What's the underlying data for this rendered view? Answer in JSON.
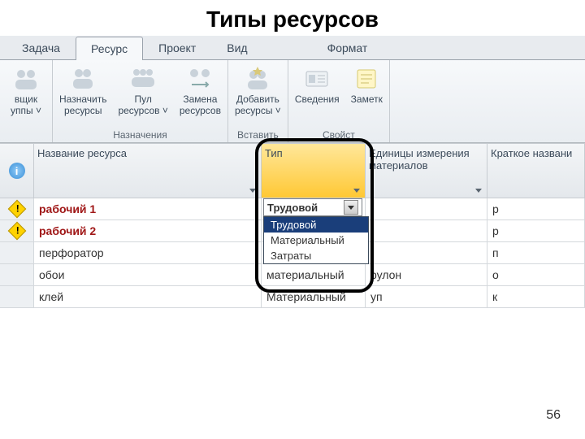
{
  "slide": {
    "title": "Типы ресурсов",
    "page_number": "56"
  },
  "tabs": {
    "task": "Задача",
    "resource": "Ресурс",
    "project": "Проект",
    "view": "Вид",
    "format": "Формат"
  },
  "ribbon": {
    "group_left_partial": {
      "btn1_line1": "вщик",
      "btn1_line2": "уппы ˅"
    },
    "assignments": {
      "label": "Назначения",
      "assign": "Назначить\nресурсы",
      "pool": "Пул\nресурсов ˅",
      "replace": "Замена\nресурсов"
    },
    "insert": {
      "label": "Вставить",
      "add": "Добавить\nресурсы ˅"
    },
    "properties": {
      "label": "Свойст",
      "details": "Сведения",
      "notes": "Заметк"
    }
  },
  "grid": {
    "headers": {
      "name": "Название ресурса",
      "type": "Тип",
      "units": "Единицы измерения материалов",
      "short": "Краткое названи"
    },
    "rows": [
      {
        "warn": true,
        "name": "рабочий 1",
        "labor": true,
        "type": "",
        "unit": "",
        "short": "р"
      },
      {
        "warn": true,
        "name": "рабочий 2",
        "labor": true,
        "type": "",
        "unit": "",
        "short": "р"
      },
      {
        "warn": false,
        "name": "перфоратор",
        "labor": false,
        "type": "",
        "unit": "",
        "short": "п"
      },
      {
        "warn": false,
        "name": "обои",
        "labor": false,
        "type": "материальный",
        "unit": "рулон",
        "short": "о"
      },
      {
        "warn": false,
        "name": "клей",
        "labor": false,
        "type": "Материальный",
        "unit": "уп",
        "short": "к"
      }
    ]
  },
  "dropdown": {
    "selected": "Трудовой",
    "options": [
      "Трудовой",
      "Материальный",
      "Затраты"
    ]
  }
}
